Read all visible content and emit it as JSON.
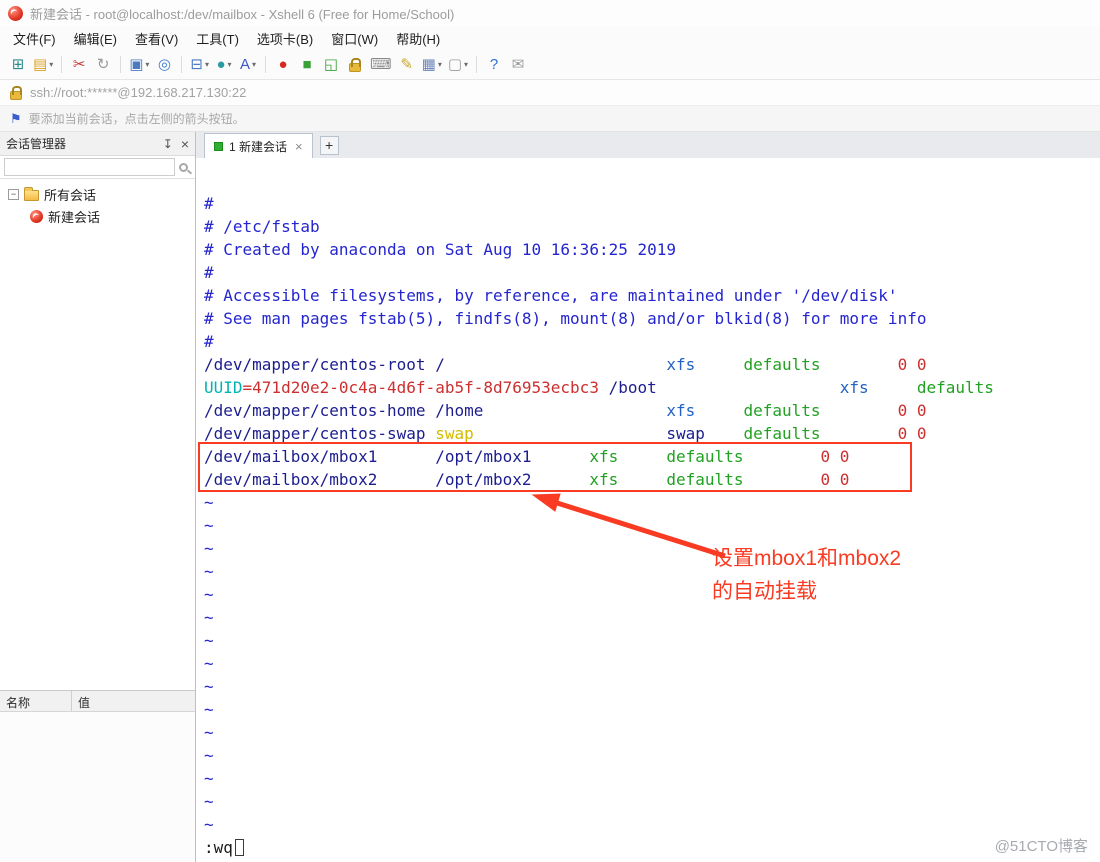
{
  "window": {
    "title": "新建会话 - root@localhost:/dev/mailbox - Xshell 6 (Free for Home/School)"
  },
  "menu": {
    "items": [
      "文件(F)",
      "编辑(E)",
      "查看(V)",
      "工具(T)",
      "选项卡(B)",
      "窗口(W)",
      "帮助(H)"
    ]
  },
  "toolbar": {
    "items": [
      {
        "name": "new-session-icon",
        "glyph": "⊞",
        "color": "#2e8b8b"
      },
      {
        "name": "open-session-icon",
        "glyph": "▤",
        "color": "#d9a021",
        "dropdown": true
      },
      {
        "type": "sep"
      },
      {
        "name": "disconnect-icon",
        "glyph": "✂",
        "color": "#cf3535"
      },
      {
        "name": "reconnect-icon",
        "glyph": "↻",
        "color": "#9a9a9a"
      },
      {
        "type": "sep"
      },
      {
        "name": "new-terminal-icon",
        "glyph": "▣",
        "color": "#4a7ac0",
        "dropdown": true
      },
      {
        "name": "find-icon",
        "glyph": "◎",
        "color": "#3f7fd0"
      },
      {
        "type": "sep"
      },
      {
        "name": "tile-layout-icon",
        "glyph": "⊟",
        "color": "#4a7ac0",
        "dropdown": true
      },
      {
        "name": "globe-icon",
        "glyph": "●",
        "color": "#2a9ba0",
        "dropdown": true
      },
      {
        "name": "font-color-icon",
        "glyph": "A",
        "color": "#3a58c8",
        "dropdown": true
      },
      {
        "type": "sep"
      },
      {
        "name": "xshell-ball-icon",
        "glyph": "●",
        "color": "#d8281e"
      },
      {
        "name": "xftp-icon",
        "glyph": "■",
        "color": "#3aa03a"
      },
      {
        "name": "fullscreen-icon",
        "glyph": "◱",
        "color": "#3aa03a"
      },
      {
        "name": "toolbar-lock-icon",
        "lock": true
      },
      {
        "name": "keyboard-icon",
        "glyph": "⌨",
        "color": "#8a8a8a"
      },
      {
        "name": "highlighter-icon",
        "glyph": "✎",
        "color": "#caa62a"
      },
      {
        "name": "package-icon",
        "glyph": "▦",
        "color": "#6a86b8",
        "dropdown": true
      },
      {
        "name": "blank-icon",
        "glyph": "▢",
        "color": "#9a9a9a",
        "dropdown": true
      },
      {
        "type": "sep"
      },
      {
        "name": "help-icon",
        "glyph": "?",
        "color": "#2f6fd0"
      },
      {
        "name": "message-icon",
        "glyph": "✉",
        "color": "#9a9a9a"
      }
    ]
  },
  "address_bar": {
    "url": "ssh://root:******@192.168.217.130:22"
  },
  "hint_bar": {
    "text": "要添加当前会话，点击左侧的箭头按钮。"
  },
  "sidebar": {
    "title": "会话管理器",
    "search_placeholder": "",
    "tree": [
      {
        "label": "所有会话"
      },
      {
        "label": "新建会话"
      }
    ],
    "properties": {
      "name_header": "名称",
      "value_header": "值"
    }
  },
  "tabs": {
    "active_label": "1 新建会话",
    "new_tab_label": "+"
  },
  "terminal": {
    "lines": [
      {
        "segs": [
          [
            "#",
            "comment"
          ]
        ]
      },
      {
        "segs": [
          [
            "# /etc/fstab",
            "comment"
          ]
        ]
      },
      {
        "segs": [
          [
            "# Created by anaconda on Sat Aug 10 16:36:25 2019",
            "comment"
          ]
        ]
      },
      {
        "segs": [
          [
            "#",
            "comment"
          ]
        ]
      },
      {
        "segs": [
          [
            "# Accessible filesystems, by reference, are maintained under '/dev/disk'",
            "comment"
          ]
        ]
      },
      {
        "segs": [
          [
            "# See man pages fstab(5), findfs(8), mount(8) and/or blkid(8) for more info",
            "comment"
          ]
        ]
      },
      {
        "segs": [
          [
            "#",
            "comment"
          ]
        ]
      },
      {
        "segs": [
          [
            "/dev/mapper/centos-root /",
            "navy"
          ],
          [
            "                       ",
            "plain"
          ],
          [
            "xfs",
            "blue"
          ],
          [
            "     ",
            "plain"
          ],
          [
            "defaults",
            "green"
          ],
          [
            "        ",
            "plain"
          ],
          [
            "0 0",
            "red"
          ]
        ]
      },
      {
        "segs": [
          [
            "UUID",
            "cyan"
          ],
          [
            "=471d20e2-0c4a-4d6f-ab5f-8d76953ecbc3",
            "red"
          ],
          [
            " /boot",
            "navy"
          ],
          [
            "                   ",
            "plain"
          ],
          [
            "xfs",
            "blue"
          ],
          [
            "     ",
            "plain"
          ],
          [
            "defaults",
            "green"
          ]
        ]
      },
      {
        "segs": [
          [
            "/dev/mapper/centos-home /home",
            "navy"
          ],
          [
            "                   ",
            "plain"
          ],
          [
            "xfs",
            "blue"
          ],
          [
            "     ",
            "plain"
          ],
          [
            "defaults",
            "green"
          ],
          [
            "        ",
            "plain"
          ],
          [
            "0 0",
            "red"
          ]
        ]
      },
      {
        "segs": [
          [
            "/dev/mapper/centos-swap ",
            "navy"
          ],
          [
            "swap",
            "yellow"
          ],
          [
            "                    ",
            "plain"
          ],
          [
            "swap",
            "navy"
          ],
          [
            "    ",
            "plain"
          ],
          [
            "defaults",
            "green"
          ],
          [
            "        ",
            "plain"
          ],
          [
            "0 0",
            "red"
          ]
        ]
      },
      {
        "segs": [
          [
            "/dev/mailbox/mbox1      /opt/mbox1      ",
            "navy"
          ],
          [
            "xfs",
            "green"
          ],
          [
            "     ",
            "plain"
          ],
          [
            "defaults",
            "green"
          ],
          [
            "        ",
            "plain"
          ],
          [
            "0 0",
            "red"
          ]
        ]
      },
      {
        "segs": [
          [
            "/dev/mailbox/mbox2      /opt/mbox2      ",
            "navy"
          ],
          [
            "xfs",
            "green"
          ],
          [
            "     ",
            "plain"
          ],
          [
            "defaults",
            "green"
          ],
          [
            "        ",
            "plain"
          ],
          [
            "0 0",
            "red"
          ]
        ]
      }
    ],
    "tilde_char": "~",
    "tilde_count": 15,
    "command": ":wq"
  },
  "annotation": {
    "line1": "设置mbox1和mbox2",
    "line2": "的自动挂载"
  },
  "watermark": "@51CTO博客",
  "colors": {
    "highlight_red": "#f83b22",
    "tab_indicator_green": "#2fae2f",
    "syntax": {
      "comment": "#2425cf",
      "navy": "#1c1d8f",
      "blue": "#2162c4",
      "green": "#21a121",
      "red": "#cd2f2f",
      "cyan": "#00b3b3",
      "yellow": "#d2bb00",
      "plain": "#1a1a1a",
      "black": "#1a1a1a"
    }
  }
}
